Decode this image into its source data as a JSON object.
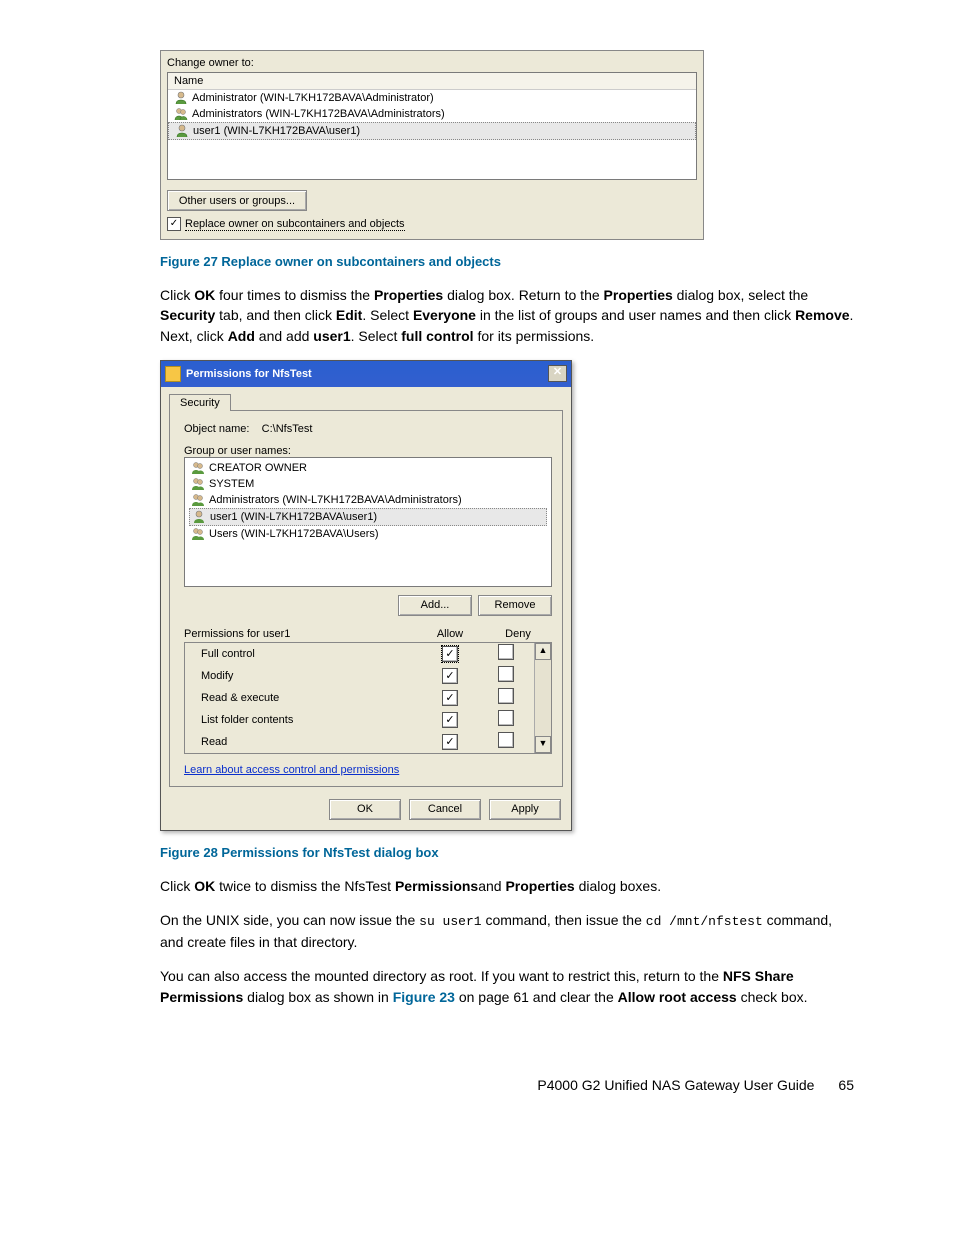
{
  "owner_dialog": {
    "change_owner_to": "Change owner to:",
    "name_header": "Name",
    "items": [
      "Administrator (WIN-L7KH172BAVA\\Administrator)",
      "Administrators (WIN-L7KH172BAVA\\Administrators)",
      "user1 (WIN-L7KH172BAVA\\user1)"
    ],
    "other_users_btn": "Other users or groups...",
    "replace_owner_chk": "Replace owner on subcontainers and objects"
  },
  "figure27_caption": "Figure 27 Replace owner on subcontainers and objects",
  "para1": {
    "a": "Click ",
    "ok": "OK",
    "b": " four times to dismiss the ",
    "properties1": "Properties",
    "c": " dialog box. Return to the ",
    "properties2": "Properties",
    "d": " dialog box, select the ",
    "security": "Security",
    "e": " tab, and then click ",
    "edit": "Edit",
    "f": ". Select ",
    "everyone": "Everyone",
    "g": " in the list of groups and user names and then click ",
    "remove": "Remove",
    "h": ". Next, click ",
    "add": "Add",
    "i": " and add ",
    "user1": "user1",
    "j": ". Select ",
    "fullcontrol": "full control",
    "k": " for its permissions."
  },
  "perm_dialog": {
    "title": "Permissions for NfsTest",
    "tab": "Security",
    "object_name_label": "Object name:",
    "object_name_value": "C:\\NfsTest",
    "group_label": "Group or user names:",
    "groups": [
      "CREATOR OWNER",
      "SYSTEM",
      "Administrators (WIN-L7KH172BAVA\\Administrators)",
      "user1 (WIN-L7KH172BAVA\\user1)",
      "Users (WIN-L7KH172BAVA\\Users)"
    ],
    "add_btn": "Add...",
    "remove_btn": "Remove",
    "perm_for": "Permissions for user1",
    "allow": "Allow",
    "deny": "Deny",
    "perms": [
      "Full control",
      "Modify",
      "Read & execute",
      "List folder contents",
      "Read"
    ],
    "learn_link": "Learn about access control and permissions",
    "ok": "OK",
    "cancel": "Cancel",
    "apply": "Apply"
  },
  "figure28_caption": "Figure 28 Permissions for NfsTest dialog box",
  "para2": {
    "a": "Click ",
    "ok": "OK",
    "b": " twice to dismiss the NfsTest ",
    "permissions": "Permissions",
    "c": "and ",
    "properties": "Properties",
    "d": " dialog boxes."
  },
  "para3": {
    "a": "On the UNIX side, you can now issue the ",
    "cmd1": "su user1",
    "b": " command, then issue the ",
    "cmd2": "cd /mnt/nfstest",
    "c": " command, and create files in that directory."
  },
  "para4": {
    "a": "You can also access the mounted directory as root. If you want to restrict this, return to the ",
    "nfs": "NFS Share Permissions",
    "b": " dialog box as shown in ",
    "fig23": "Figure 23",
    "c": " on page 61 and clear the ",
    "allowroot": "Allow root access",
    "d": " check box."
  },
  "footer": {
    "title": "P4000 G2 Unified NAS Gateway User Guide",
    "page": "65"
  }
}
